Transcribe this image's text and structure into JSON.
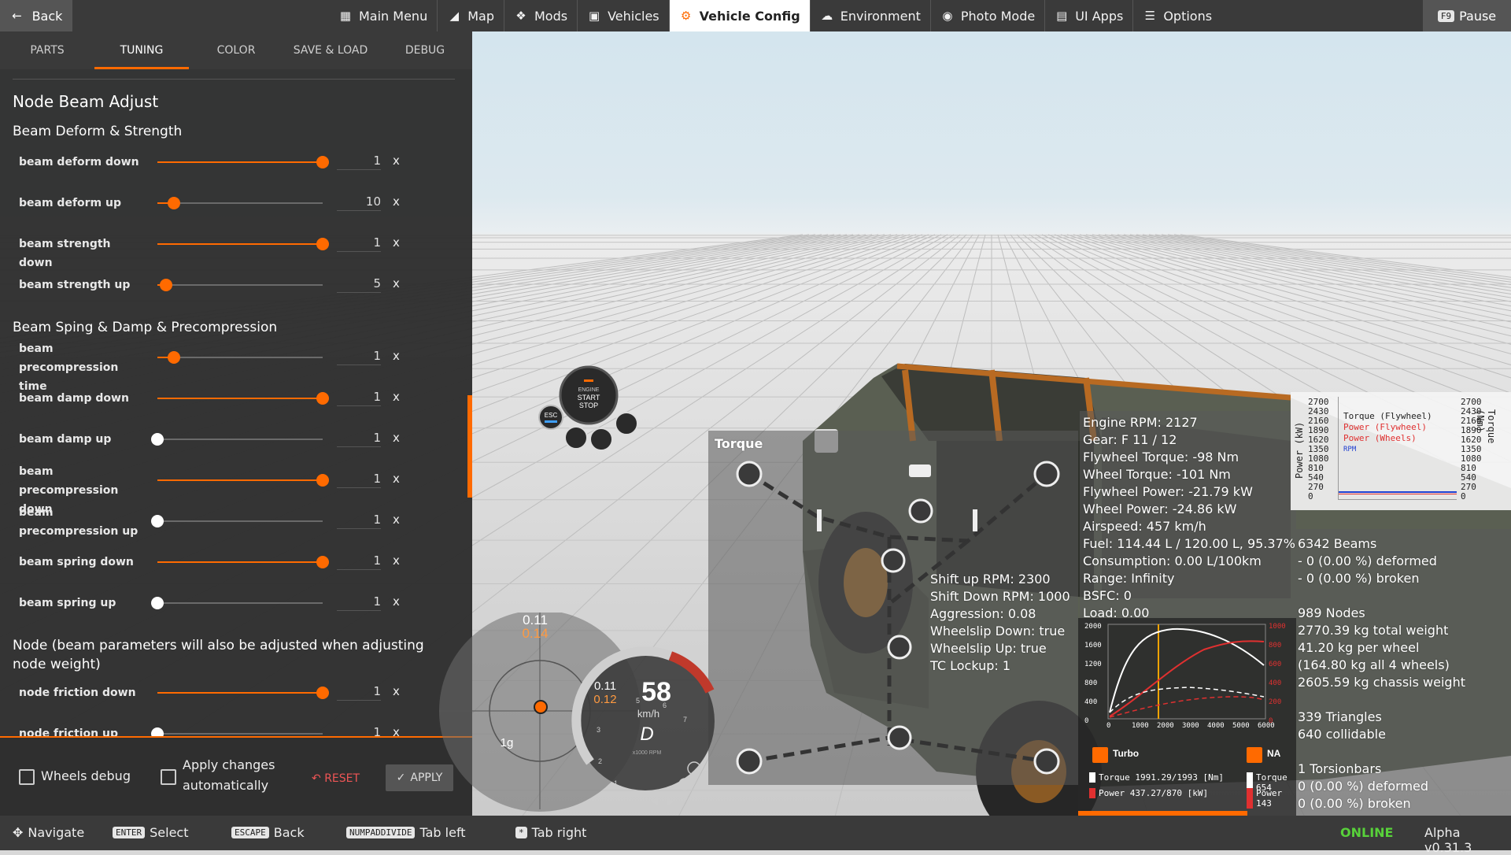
{
  "topbar": {
    "back_label": "Back",
    "nav": [
      {
        "label": "Main Menu",
        "icon": "grid-icon"
      },
      {
        "label": "Map",
        "icon": "map-icon"
      },
      {
        "label": "Mods",
        "icon": "puzzle-icon"
      },
      {
        "label": "Vehicles",
        "icon": "car-icon"
      },
      {
        "label": "Vehicle Config",
        "icon": "engine-icon"
      },
      {
        "label": "Environment",
        "icon": "weather-icon"
      },
      {
        "label": "Photo Mode",
        "icon": "camera-icon"
      },
      {
        "label": "UI Apps",
        "icon": "apps-icon"
      },
      {
        "label": "Options",
        "icon": "sliders-icon"
      }
    ],
    "active_nav": "Vehicle Config",
    "pause_key": "F9",
    "pause_label": "Pause"
  },
  "panel": {
    "tabs": [
      "PARTS",
      "TUNING",
      "COLOR",
      "SAVE & LOAD",
      "DEBUG"
    ],
    "active_tab": "TUNING",
    "title": "Node Beam Adjust",
    "section1": "Beam Deform & Strength",
    "section2": "Beam Sping & Damp & Precompression",
    "section3": "Node (beam parameters will also be adjusted when adjusting node weight)",
    "rows": [
      {
        "label": "beam deform down",
        "value": "1",
        "unit": "x",
        "level": 1.0
      },
      {
        "label": "beam deform up",
        "value": "10",
        "unit": "x",
        "level": 0.1
      },
      {
        "label": "beam strength down",
        "value": "1",
        "unit": "x",
        "level": 1.0
      },
      {
        "label": "beam strength up",
        "value": "5",
        "unit": "x",
        "level": 0.05
      },
      {
        "label": "beam precompression time",
        "value": "1",
        "unit": "x",
        "level": 0.1
      },
      {
        "label": "beam damp down",
        "value": "1",
        "unit": "x",
        "level": 1.0
      },
      {
        "label": "beam damp up",
        "value": "1",
        "unit": "x",
        "level": 0.0
      },
      {
        "label": "beam precompression down",
        "value": "1",
        "unit": "x",
        "level": 1.0
      },
      {
        "label": "beam precompression up",
        "value": "1",
        "unit": "x",
        "level": 0.0
      },
      {
        "label": "beam spring down",
        "value": "1",
        "unit": "x",
        "level": 1.0
      },
      {
        "label": "beam spring up",
        "value": "1",
        "unit": "x",
        "level": 0.0
      },
      {
        "label": "node friction down",
        "value": "1",
        "unit": "x",
        "level": 1.0
      },
      {
        "label": "node friction up",
        "value": "1",
        "unit": "x",
        "level": 0.0
      }
    ],
    "footer": {
      "wheels_debug_label": "Wheels debug",
      "apply_auto_label": "Apply changes automatically",
      "reset_label": "RESET",
      "apply_label": "APPLY"
    }
  },
  "bottombar": {
    "hints": [
      {
        "key": "",
        "label": "Navigate"
      },
      {
        "key": "ENTER",
        "label": "Select"
      },
      {
        "key": "ESCAPE",
        "label": "Back"
      },
      {
        "key": "NUMPADDIVIDE",
        "label": "Tab left"
      },
      {
        "key": "*",
        "label": "Tab right"
      }
    ],
    "status": "ONLINE",
    "version": "Alpha v0.31.3"
  },
  "hud": {
    "engine_button": [
      "ENGINE",
      "START",
      "STOP"
    ],
    "esc_label": "ESC",
    "torque_title": "Torque",
    "gear_info": [
      "Shift up RPM: 2300",
      "Shift Down RPM: 1000",
      "Aggression: 0.08",
      "Wheelslip Down: true",
      "Wheelslip Up: true",
      "TC Lockup: 1"
    ],
    "engine_info": [
      "Engine RPM: 2127",
      "Gear: F 11 / 12",
      "Flywheel Torque: -98 Nm",
      "Wheel Torque: -101 Nm",
      "Flywheel Power: -21.79 kW",
      "Wheel Power: -24.86 kW",
      "Airspeed: 457 km/h",
      "Fuel: 114.44 L / 120.00 L, 95.37%",
      "Consumption: 0.00 L/100km",
      "Range: Infinity",
      "BSFC: 0",
      "Load: 0.00"
    ],
    "stats": [
      "6342 Beams",
      "- 0 (0.00 %) deformed",
      "- 0 (0.00 %) broken",
      "",
      "989 Nodes",
      "2770.39 kg total weight",
      "41.20 kg per wheel",
      "(164.80 kg all 4 wheels)",
      "2605.59 kg chassis weight",
      "",
      "339 Triangles",
      "640 collidable",
      "",
      "1 Torsionbars",
      "0 (0.00 %) deformed",
      "0 (0.00 %) broken"
    ],
    "graph": {
      "left_axis": "Power (kW)",
      "right_axis": "Torque (Nm)",
      "ticks": [
        "2700",
        "2430",
        "2160",
        "1890",
        "1620",
        "1350",
        "1080",
        "810",
        "540",
        "270",
        "0"
      ],
      "legend": [
        "Torque (Flywheel)",
        "Power (Flywheel)",
        "Power (Wheels)",
        "RPM"
      ],
      "legend_colors": [
        "#222222",
        "#e03030",
        "#e03030",
        "#2040d0"
      ]
    },
    "gforce": {
      "top_value": "0.11",
      "orange_value": "0.14",
      "label": "1g"
    },
    "speedo": {
      "small_top": "0.11",
      "small_orange": "0.12",
      "speed": "58",
      "unit": "km/h",
      "gear": "D",
      "rpm_label": "x1000 RPM",
      "ticks": [
        "5",
        "6",
        "7",
        "3",
        "2",
        "1"
      ]
    },
    "dyno": {
      "y_ticks": [
        "2000",
        "1600",
        "1200",
        "800",
        "400",
        "0"
      ],
      "x_ticks": [
        "0",
        "1000",
        "2000",
        "3000",
        "4000",
        "5000",
        "6000"
      ],
      "right_ticks": [
        "1000",
        "800",
        "600",
        "400",
        "200",
        "0"
      ],
      "turbo_label": "Turbo",
      "na_label": "NA",
      "turbo_torque": "Torque 1991.29/1993 [Nm]",
      "turbo_power": "Power  437.27/870  [kW]",
      "na_torque": "Torque 654",
      "na_power": "Power  143"
    }
  }
}
